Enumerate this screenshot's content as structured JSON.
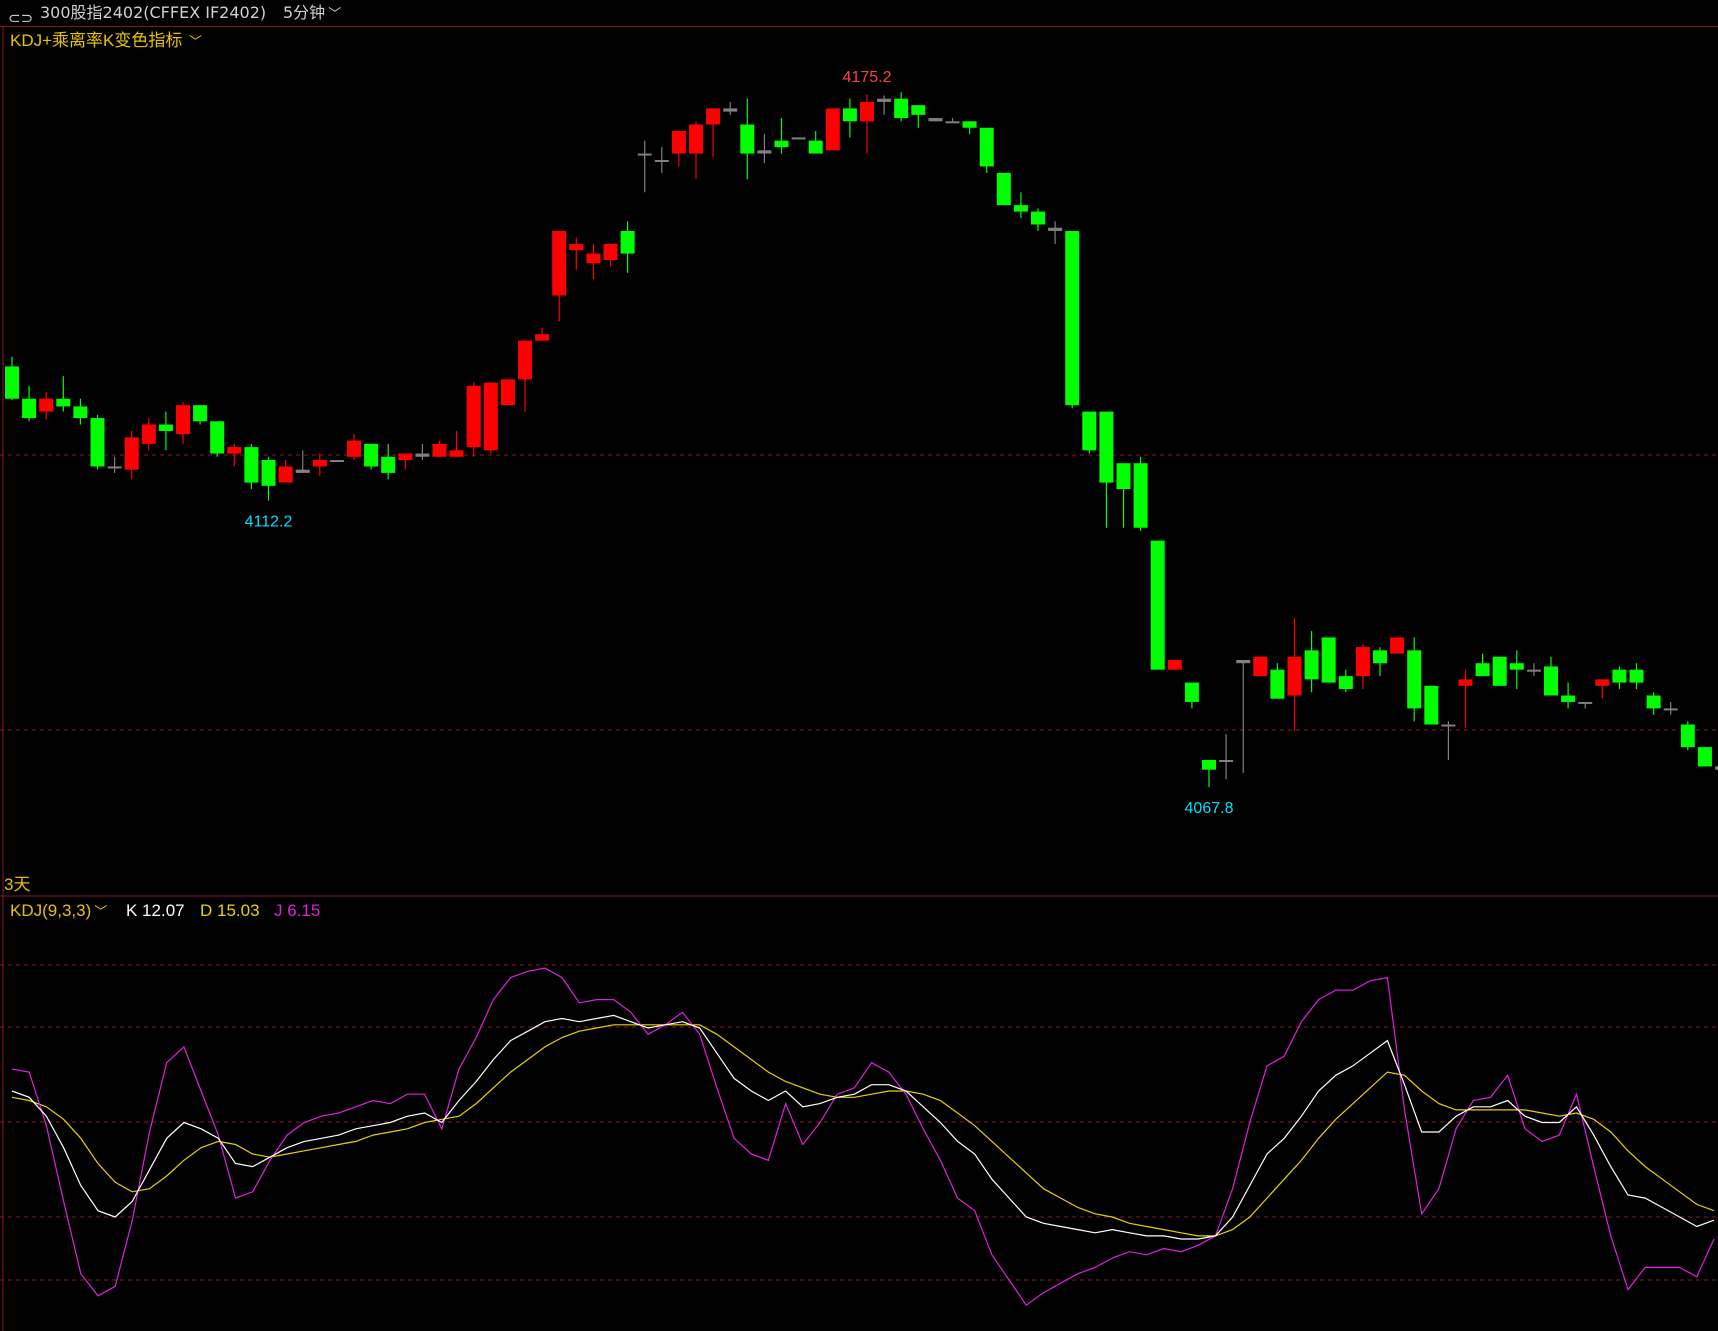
{
  "header": {
    "symbol": "300股指2402(CFFEX IF2402)",
    "period": "5分钟"
  },
  "main_panel": {
    "indicator_label": "KDJ+乘离率K变色指标",
    "range_label": "3天"
  },
  "sub_panel": {
    "indicator_label": "KDJ(9,3,3)",
    "k_label": "K 12.07",
    "d_label": "D 15.03",
    "j_label": "J 6.15"
  },
  "colors": {
    "up": "#ff0000",
    "down": "#00ff00",
    "neutral": "#808080",
    "k_line": "#ffffff",
    "d_line": "#e6d200",
    "j_line": "#e020e0",
    "high_label": "#ff4040",
    "low_label": "#00e0ff",
    "grid": "#8b1a1a"
  },
  "chart_data": [
    {
      "type": "candlestick",
      "high_annotation": {
        "value": 4175.2,
        "index": 50
      },
      "low_annotation": [
        {
          "value": 4112.2,
          "index": 15
        },
        {
          "value": 4067.8,
          "index": 70
        }
      ],
      "ohlc": [
        [
          4133.0,
          4134.5,
          4127.8,
          4128.0
        ],
        [
          4128.0,
          4130.0,
          4124.5,
          4125.0
        ],
        [
          4126.0,
          4129.0,
          4124.8,
          4128.0
        ],
        [
          4128.0,
          4131.5,
          4126.0,
          4126.8
        ],
        [
          4126.8,
          4128.0,
          4124.0,
          4125.0
        ],
        [
          4125.0,
          4125.5,
          4117.0,
          4117.5
        ],
        [
          4117.5,
          4119.0,
          4116.5,
          4117.5
        ],
        [
          4117.0,
          4123.0,
          4115.5,
          4122.0
        ],
        [
          4121.0,
          4125.0,
          4120.0,
          4124.0
        ],
        [
          4124.0,
          4126.0,
          4120.0,
          4123.0
        ],
        [
          4122.5,
          4127.5,
          4121.0,
          4127.0
        ],
        [
          4127.0,
          4127.0,
          4124.0,
          4124.5
        ],
        [
          4124.5,
          4124.5,
          4119.0,
          4119.5
        ],
        [
          4119.5,
          4121.0,
          4117.5,
          4120.5
        ],
        [
          4120.5,
          4121.0,
          4114.0,
          4115.0
        ],
        [
          4118.5,
          4119.0,
          4112.2,
          4114.5
        ],
        [
          4115.0,
          4118.5,
          4115.0,
          4117.5
        ],
        [
          4116.5,
          4120.0,
          4116.5,
          4117.0
        ],
        [
          4117.5,
          4119.5,
          4116.0,
          4118.5
        ],
        [
          4118.5,
          4118.5,
          4118.5,
          4118.5
        ],
        [
          4119.0,
          4122.5,
          4118.5,
          4121.5
        ],
        [
          4121.0,
          4121.0,
          4117.0,
          4117.5
        ],
        [
          4119.0,
          4121.0,
          4115.5,
          4116.5
        ],
        [
          4118.5,
          4119.5,
          4117.0,
          4119.5
        ],
        [
          4119.0,
          4121.0,
          4118.5,
          4119.5
        ],
        [
          4119.0,
          4121.5,
          4119.0,
          4121.0
        ],
        [
          4119.0,
          4123.0,
          4119.0,
          4120.0
        ],
        [
          4120.5,
          4130.5,
          4119.0,
          4130.0
        ],
        [
          4120.0,
          4130.5,
          4119.5,
          4130.5
        ],
        [
          4127.0,
          4131.0,
          4127.0,
          4131.0
        ],
        [
          4131.0,
          4136.0,
          4126.0,
          4137.0
        ],
        [
          4137.0,
          4139.0,
          4137.5,
          4138.0
        ],
        [
          4144.0,
          4153.0,
          4140.0,
          4154.0
        ],
        [
          4151.0,
          4153.0,
          4148.0,
          4152.0
        ],
        [
          4149.0,
          4152.0,
          4146.5,
          4150.5
        ],
        [
          4149.5,
          4152.0,
          4148.5,
          4152.0
        ],
        [
          4154.0,
          4155.5,
          4147.5,
          4150.5
        ],
        [
          4166.0,
          4168.0,
          4160.0,
          4166.0
        ],
        [
          4165.0,
          4167.0,
          4163.0,
          4165.0
        ],
        [
          4166.0,
          4169.0,
          4164.0,
          4169.5
        ],
        [
          4166.0,
          4171.0,
          4162.0,
          4170.5
        ],
        [
          4170.5,
          4172.5,
          4165.5,
          4173.0
        ],
        [
          4173.0,
          4174.0,
          4172.0,
          4172.5
        ],
        [
          4170.5,
          4174.5,
          4162.0,
          4166.0
        ],
        [
          4166.5,
          4169.0,
          4164.5,
          4166.0
        ],
        [
          4168.0,
          4171.5,
          4166.0,
          4167.0
        ],
        [
          4168.5,
          4168.5,
          4168.5,
          4168.5
        ],
        [
          4168.0,
          4169.5,
          4166.0,
          4166.0
        ],
        [
          4166.5,
          4170.0,
          4166.5,
          4173.0
        ],
        [
          4173.0,
          4174.5,
          4168.5,
          4171.0
        ],
        [
          4171.0,
          4175.2,
          4166.0,
          4174.0
        ],
        [
          4174.0,
          4175.0,
          4172.0,
          4174.5
        ],
        [
          4174.5,
          4175.5,
          4171.0,
          4171.5
        ],
        [
          4173.5,
          4173.0,
          4170.0,
          4172.0
        ],
        [
          4171.5,
          4171.0,
          4171.0,
          4171.0
        ],
        [
          4171.0,
          4171.5,
          4171.0,
          4171.0
        ],
        [
          4171.0,
          4170.0,
          4169.0,
          4170.0
        ],
        [
          4170.0,
          4164.0,
          4163.0,
          4164.0
        ],
        [
          4163.0,
          4163.0,
          4158.0,
          4158.0
        ],
        [
          4158.0,
          4160.0,
          4156.0,
          4157.0
        ],
        [
          4157.0,
          4157.5,
          4154.0,
          4155.0
        ],
        [
          4154.5,
          4155.5,
          4152.0,
          4154.0
        ],
        [
          4154.0,
          4154.0,
          4126.5,
          4127.0
        ],
        [
          4126.0,
          4126.0,
          4119.5,
          4120.0
        ],
        [
          4126.0,
          4126.0,
          4108.0,
          4115.0
        ],
        [
          4118.0,
          4118.0,
          4108.0,
          4114.0
        ],
        [
          4118.0,
          4119.0,
          4107.5,
          4108.0
        ],
        [
          4106.0,
          4106.0,
          4086.0,
          4086.0
        ],
        [
          4086.0,
          4086.5,
          4087.5,
          4087.5
        ],
        [
          4084.0,
          4084.0,
          4080.0,
          4081.0
        ],
        [
          4072.0,
          4072.0,
          4067.8,
          4070.5
        ],
        [
          4072.0,
          4076.0,
          4069.0,
          4072.0
        ],
        [
          4087.5,
          4087.0,
          4070.0,
          4087.0
        ],
        [
          4085.0,
          4088.0,
          4085.5,
          4088.0
        ],
        [
          4086.0,
          4087.0,
          4082.5,
          4081.5
        ],
        [
          4082.0,
          4094.0,
          4076.5,
          4088.0
        ],
        [
          4089.0,
          4092.0,
          4082.5,
          4084.5
        ],
        [
          4091.0,
          4091.0,
          4084.0,
          4084.0
        ],
        [
          4085.0,
          4086.0,
          4082.5,
          4083.0
        ],
        [
          4085.0,
          4090.0,
          4083.0,
          4089.5
        ],
        [
          4089.0,
          4089.5,
          4085.0,
          4087.0
        ],
        [
          4088.5,
          4091.0,
          4088.5,
          4091.0
        ],
        [
          4089.0,
          4091.0,
          4078.0,
          4080.0
        ],
        [
          4083.5,
          4083.0,
          4077.5,
          4077.5
        ],
        [
          4077.5,
          4078.0,
          4072.0,
          4077.5
        ],
        [
          4083.5,
          4086.0,
          4077.0,
          4084.5
        ],
        [
          4087.0,
          4088.5,
          4085.0,
          4085.0
        ],
        [
          4088.0,
          4087.5,
          4084.0,
          4083.5
        ],
        [
          4087.0,
          4089.0,
          4083.0,
          4086.0
        ],
        [
          4086.0,
          4087.0,
          4085.0,
          4086.0
        ],
        [
          4086.5,
          4088.0,
          4082.0,
          4082.0
        ],
        [
          4082.0,
          4084.0,
          4080.0,
          4081.0
        ],
        [
          4081.0,
          4081.0,
          4080.0,
          4081.0
        ],
        [
          4083.5,
          4084.0,
          4081.5,
          4084.5
        ],
        [
          4086.0,
          4086.5,
          4083.0,
          4084.0
        ],
        [
          4086.0,
          4087.0,
          4083.0,
          4084.0
        ],
        [
          4082.0,
          4082.5,
          4079.0,
          4080.0
        ],
        [
          4080.0,
          4081.0,
          4079.0,
          4080.0
        ],
        [
          4077.5,
          4078.0,
          4073.5,
          4074.0
        ],
        [
          4074.0,
          4074.0,
          4071.0,
          4071.0
        ],
        [
          4071.0,
          4075.0,
          4070.5,
          4070.5
        ],
        [
          4071.0,
          4073.0,
          4070.0,
          4073.0
        ],
        [
          4069.0,
          4070.0,
          4067.5,
          4067.5
        ],
        [
          4063.0,
          4063.0,
          4061.5,
          4064.5
        ],
        [
          4061.0,
          4063.0,
          4061.0,
          4063.0
        ]
      ],
      "yrange": [
        4059.6,
        4180.5
      ]
    },
    {
      "type": "line",
      "name": "KDJ",
      "yrange": [
        0,
        100
      ],
      "K": [
        60,
        58,
        52,
        42,
        30,
        22,
        20,
        25,
        35,
        45,
        50,
        48,
        45,
        37,
        36,
        39,
        42,
        44,
        45,
        46,
        48,
        49,
        50,
        52,
        53,
        50,
        57,
        63,
        70,
        76,
        79,
        82,
        83,
        82,
        83,
        84,
        82,
        80,
        81,
        82,
        80,
        72,
        64,
        60,
        57,
        60,
        55,
        56,
        58,
        59,
        62,
        62,
        60,
        55,
        50,
        44,
        40,
        32,
        26,
        20,
        18,
        17,
        16,
        15,
        16,
        15,
        14,
        14,
        13,
        13,
        14,
        20,
        30,
        40,
        45,
        52,
        60,
        65,
        68,
        72,
        76,
        62,
        47,
        47,
        52,
        55,
        55,
        57,
        52,
        50,
        50,
        55,
        46,
        36,
        27,
        26,
        23,
        20,
        17,
        19
      ],
      "D": [
        58,
        57,
        55,
        51,
        45,
        37,
        31,
        28,
        29,
        33,
        38,
        42,
        44,
        43,
        40,
        39,
        40,
        41,
        42,
        43,
        44,
        46,
        47,
        48,
        50,
        51,
        52,
        56,
        61,
        66,
        70,
        74,
        77,
        79,
        80,
        81,
        81,
        81,
        81,
        81,
        81,
        78,
        74,
        70,
        66,
        63,
        61,
        59,
        58,
        58,
        59,
        60,
        60,
        59,
        57,
        53,
        49,
        44,
        39,
        34,
        29,
        26,
        23,
        21,
        20,
        18,
        17,
        16,
        15,
        14,
        14,
        16,
        20,
        26,
        32,
        38,
        45,
        51,
        56,
        61,
        66,
        65,
        60,
        56,
        54,
        54,
        54,
        54,
        54,
        53,
        52,
        53,
        51,
        47,
        41,
        36,
        32,
        28,
        24,
        22
      ],
      "J": [
        67,
        66,
        49,
        25,
        2,
        -5,
        -2,
        19,
        47,
        69,
        74,
        60,
        46,
        26,
        28,
        38,
        46,
        50,
        52,
        53,
        55,
        57,
        56,
        59,
        59,
        48,
        67,
        77,
        89,
        96,
        98,
        99,
        96,
        88,
        89,
        89,
        85,
        78,
        81,
        85,
        78,
        61,
        45,
        40,
        38,
        56,
        43,
        50,
        59,
        61,
        69,
        66,
        59,
        48,
        38,
        26,
        22,
        8,
        0,
        -8,
        -4,
        -1,
        2,
        4,
        7,
        9,
        8,
        10,
        9,
        11,
        14,
        29,
        50,
        68,
        71,
        82,
        89,
        92,
        92,
        95,
        96,
        54,
        21,
        29,
        48,
        57,
        58,
        65,
        48,
        44,
        46,
        59,
        36,
        14,
        -3,
        4,
        4,
        4,
        1,
        13
      ]
    }
  ]
}
